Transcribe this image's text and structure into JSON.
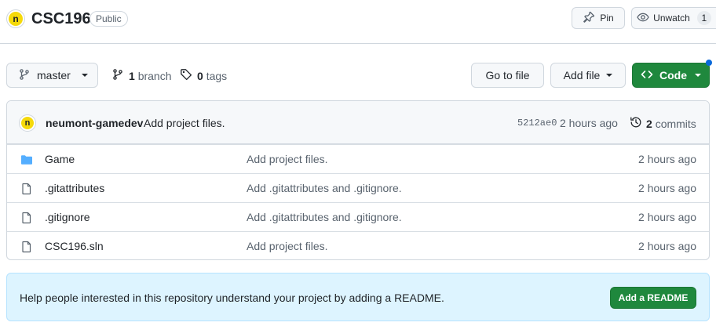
{
  "header": {
    "avatar_letter": "n",
    "repo_name": "CSC196",
    "visibility": "Public",
    "pin_label": "Pin",
    "unwatch_label": "Unwatch",
    "watch_count": "1"
  },
  "nav": {
    "branch_name": "master",
    "branch_count": "1",
    "branch_label": "branch",
    "tag_count": "0",
    "tag_label": "tags",
    "goto_file_label": "Go to file",
    "add_file_label": "Add file",
    "code_label": "Code"
  },
  "commit": {
    "avatar_letter": "n",
    "author": "neumont-gamedev",
    "message": "Add project files.",
    "sha": "5212ae0",
    "time": "2 hours ago",
    "commit_count": "2",
    "commit_label": "commits"
  },
  "files": [
    {
      "type": "folder",
      "name": "Game",
      "message": "Add project files.",
      "age": "2 hours ago"
    },
    {
      "type": "file",
      "name": ".gitattributes",
      "message": "Add .gitattributes and .gitignore.",
      "age": "2 hours ago"
    },
    {
      "type": "file",
      "name": ".gitignore",
      "message": "Add .gitattributes and .gitignore.",
      "age": "2 hours ago"
    },
    {
      "type": "file",
      "name": "CSC196.sln",
      "message": "Add project files.",
      "age": "2 hours ago"
    }
  ],
  "readme_banner": {
    "text": "Help people interested in this repository understand your project by adding a README.",
    "button_label": "Add a README"
  },
  "colors": {
    "primary_green": "#1f883d",
    "accent_blue": "#0969da",
    "folder_blue": "#54aeff",
    "avatar_yellow": "#f5d90a",
    "banner_bg": "#ddf4ff"
  }
}
